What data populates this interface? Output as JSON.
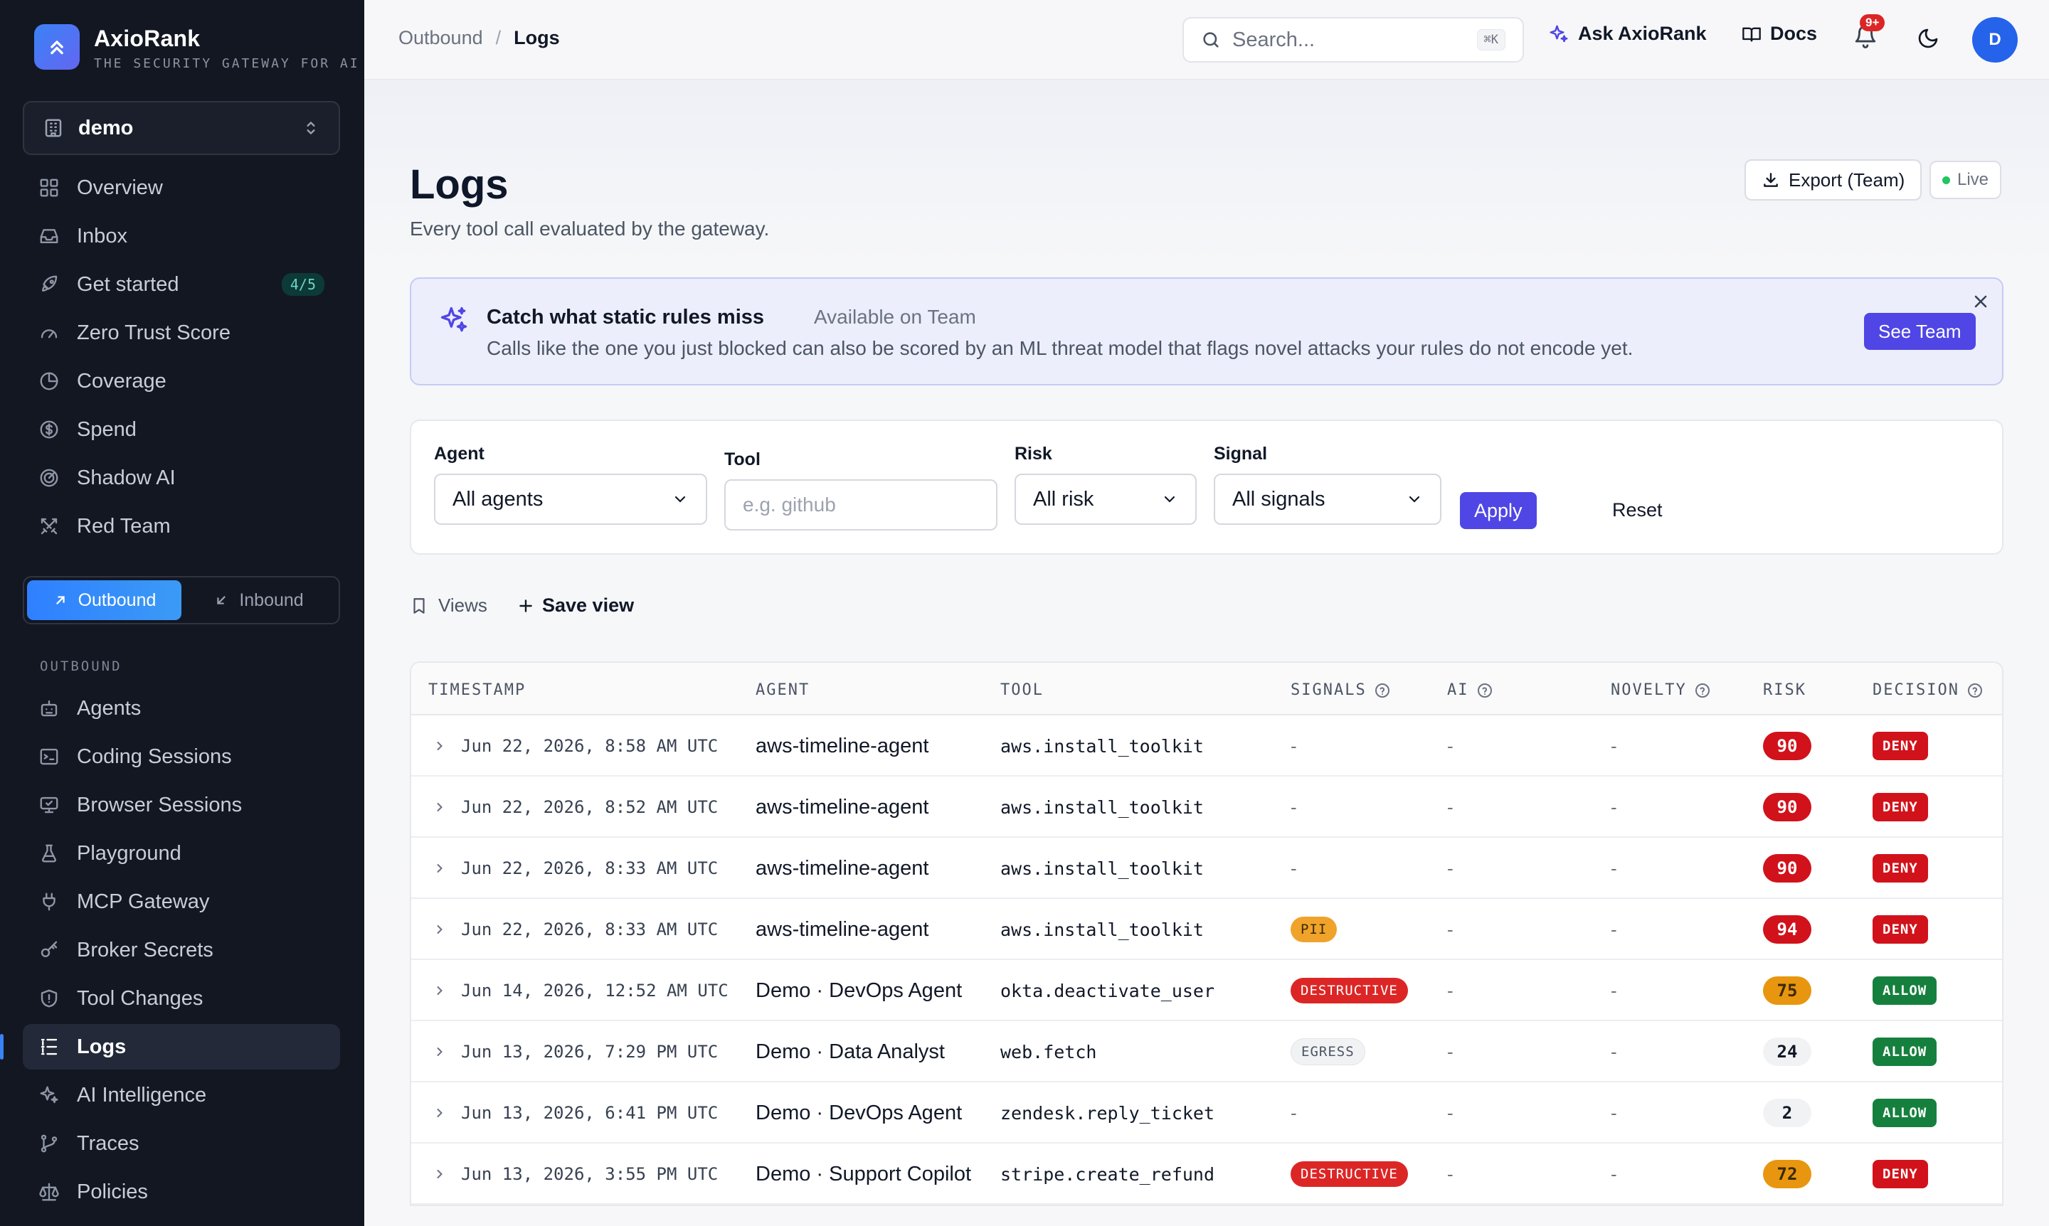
{
  "brand": {
    "name": "AxioRank",
    "tagline": "THE SECURITY GATEWAY FOR AI AG"
  },
  "workspace": {
    "name": "demo"
  },
  "nav_top": [
    {
      "key": "overview",
      "label": "Overview",
      "icon": "grid-icon"
    },
    {
      "key": "inbox",
      "label": "Inbox",
      "icon": "inbox-icon"
    },
    {
      "key": "get-started",
      "label": "Get started",
      "icon": "rocket-icon",
      "badge": "4/5"
    },
    {
      "key": "zero-trust-score",
      "label": "Zero Trust Score",
      "icon": "gauge-icon"
    },
    {
      "key": "coverage",
      "label": "Coverage",
      "icon": "coverage-icon"
    },
    {
      "key": "spend",
      "label": "Spend",
      "icon": "dollar-icon"
    },
    {
      "key": "shadow-ai",
      "label": "Shadow AI",
      "icon": "radar-icon"
    },
    {
      "key": "red-team",
      "label": "Red Team",
      "icon": "swords-icon"
    }
  ],
  "direction": {
    "outbound": "Outbound",
    "inbound": "Inbound",
    "selected": "Outbound"
  },
  "section_label": "OUTBOUND",
  "nav_outbound": [
    {
      "key": "agents",
      "label": "Agents",
      "icon": "bot-icon"
    },
    {
      "key": "coding-sessions",
      "label": "Coding Sessions",
      "icon": "terminal-icon"
    },
    {
      "key": "browser-sessions",
      "label": "Browser Sessions",
      "icon": "monitor-icon"
    },
    {
      "key": "playground",
      "label": "Playground",
      "icon": "flask-icon"
    },
    {
      "key": "mcp-gateway",
      "label": "MCP Gateway",
      "icon": "plug-icon"
    },
    {
      "key": "broker-secrets",
      "label": "Broker Secrets",
      "icon": "key-icon"
    },
    {
      "key": "tool-changes",
      "label": "Tool Changes",
      "icon": "shield-icon"
    },
    {
      "key": "logs",
      "label": "Logs",
      "icon": "logs-icon",
      "active": true
    },
    {
      "key": "ai-intelligence",
      "label": "AI Intelligence",
      "icon": "sparkles-icon"
    },
    {
      "key": "traces",
      "label": "Traces",
      "icon": "git-branch-icon"
    },
    {
      "key": "policies",
      "label": "Policies",
      "icon": "scale-icon"
    }
  ],
  "breadcrumb": {
    "parent": "Outbound",
    "sep": "/",
    "current": "Logs"
  },
  "topbar": {
    "search_placeholder": "Search...",
    "search_shortcut": "⌘K",
    "ask_label": "Ask AxioRank",
    "docs_label": "Docs",
    "notif_count": "9+",
    "avatar_initial": "D"
  },
  "page": {
    "title": "Logs",
    "subtitle": "Every tool call evaluated by the gateway.",
    "export_label": "Export (Team)",
    "live_label": "Live"
  },
  "promo": {
    "title": "Catch what static rules miss",
    "availability": "Available on Team",
    "body": "Calls like the one you just blocked can also be scored by an ML threat model that flags novel attacks your rules do not encode yet.",
    "cta": "See Team"
  },
  "filters": {
    "agent_label": "Agent",
    "agent_value": "All agents",
    "tool_label": "Tool",
    "tool_placeholder": "e.g. github",
    "risk_label": "Risk",
    "risk_value": "All risk",
    "signal_label": "Signal",
    "signal_value": "All signals",
    "apply_label": "Apply",
    "reset_label": "Reset"
  },
  "views": {
    "views_label": "Views",
    "save_label": "Save view"
  },
  "table": {
    "columns": {
      "timestamp": "TIMESTAMP",
      "agent": "AGENT",
      "tool": "TOOL",
      "signals": "SIGNALS",
      "ai": "AI",
      "novelty": "NOVELTY",
      "risk": "RISK",
      "decision": "DECISION"
    },
    "rows": [
      {
        "timestamp": "Jun 22, 2026, 8:58 AM UTC",
        "agent": "aws-timeline-agent",
        "tool": "aws.install_toolkit",
        "signal": "-",
        "signal_kind": "",
        "ai": "-",
        "novelty": "-",
        "risk": "90",
        "risk_level": "high",
        "decision": "DENY"
      },
      {
        "timestamp": "Jun 22, 2026, 8:52 AM UTC",
        "agent": "aws-timeline-agent",
        "tool": "aws.install_toolkit",
        "signal": "-",
        "signal_kind": "",
        "ai": "-",
        "novelty": "-",
        "risk": "90",
        "risk_level": "high",
        "decision": "DENY"
      },
      {
        "timestamp": "Jun 22, 2026, 8:33 AM UTC",
        "agent": "aws-timeline-agent",
        "tool": "aws.install_toolkit",
        "signal": "-",
        "signal_kind": "",
        "ai": "-",
        "novelty": "-",
        "risk": "90",
        "risk_level": "high",
        "decision": "DENY"
      },
      {
        "timestamp": "Jun 22, 2026, 8:33 AM UTC",
        "agent": "aws-timeline-agent",
        "tool": "aws.install_toolkit",
        "signal": "PII",
        "signal_kind": "pii",
        "ai": "-",
        "novelty": "-",
        "risk": "94",
        "risk_level": "high",
        "decision": "DENY"
      },
      {
        "timestamp": "Jun 14, 2026, 12:52 AM UTC",
        "agent": "Demo · DevOps Agent",
        "tool": "okta.deactivate_user",
        "signal": "DESTRUCTIVE",
        "signal_kind": "destructive",
        "ai": "-",
        "novelty": "-",
        "risk": "75",
        "risk_level": "med",
        "decision": "ALLOW"
      },
      {
        "timestamp": "Jun 13, 2026, 7:29 PM UTC",
        "agent": "Demo · Data Analyst",
        "tool": "web.fetch",
        "signal": "EGRESS",
        "signal_kind": "egress",
        "ai": "-",
        "novelty": "-",
        "risk": "24",
        "risk_level": "low",
        "decision": "ALLOW"
      },
      {
        "timestamp": "Jun 13, 2026, 6:41 PM UTC",
        "agent": "Demo · DevOps Agent",
        "tool": "zendesk.reply_ticket",
        "signal": "-",
        "signal_kind": "",
        "ai": "-",
        "novelty": "-",
        "risk": "2",
        "risk_level": "low",
        "decision": "ALLOW"
      },
      {
        "timestamp": "Jun 13, 2026, 3:55 PM UTC",
        "agent": "Demo · Support Copilot",
        "tool": "stripe.create_refund",
        "signal": "DESTRUCTIVE",
        "signal_kind": "destructive",
        "ai": "-",
        "novelty": "-",
        "risk": "72",
        "risk_level": "med",
        "decision": "DENY"
      }
    ]
  },
  "colors": {
    "sidebar_bg": "#131722",
    "accent_blue": "#3b82f6",
    "indigo": "#4f46e5",
    "deny_red": "#d1121b",
    "allow_green": "#15803d",
    "warn_amber": "#e8960f"
  }
}
